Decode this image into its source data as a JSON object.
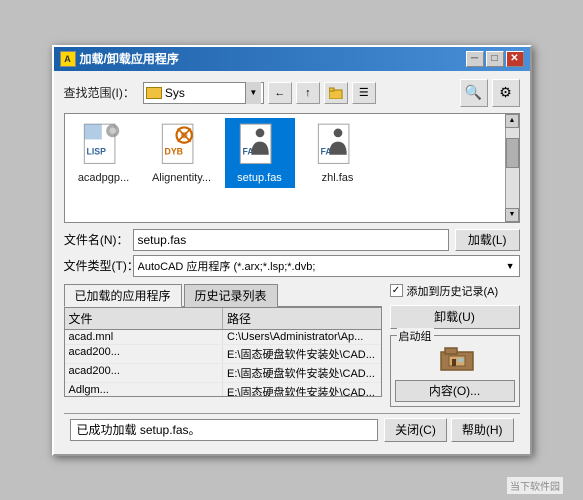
{
  "window": {
    "title": "加载/卸载应用程序",
    "title_icon": "A",
    "close_btn": "✕",
    "min_btn": "─",
    "max_btn": "□"
  },
  "search": {
    "label": "查找范围(I)：",
    "value": "Sys",
    "placeholder": "Sys"
  },
  "toolbar": {
    "back": "←",
    "up": "↑",
    "folder": "📁",
    "view": "☰",
    "search_icon": "🔍",
    "settings_icon": "⚙"
  },
  "files": [
    {
      "name": "acadpgp...",
      "type": "LISP"
    },
    {
      "name": "Alignentity...",
      "type": "DYB"
    },
    {
      "name": "setup.fas",
      "type": "FAS",
      "selected": true
    },
    {
      "name": "zhl.fas",
      "type": "FAS"
    }
  ],
  "form": {
    "filename_label": "文件名(N)：",
    "filename_value": "setup.fas",
    "filetype_label": "文件类型(T)：",
    "filetype_value": "AutoCAD 应用程序 (*.arx;*.lsp;*.dvb;",
    "load_btn": "加载(L)"
  },
  "loaded_apps": {
    "tab1": "已加载的应用程序",
    "tab2": "历史记录列表",
    "cols": [
      "文件",
      "路径"
    ],
    "rows": [
      {
        "file": "acad.mnl",
        "path": "C:\\Users\\Administrator\\Ap..."
      },
      {
        "file": "acad200...",
        "path": "E:\\固态硬盘软件安装处\\CAD..."
      },
      {
        "file": "acad200...",
        "path": "E:\\固态硬盘软件安装处\\CAD..."
      },
      {
        "file": "Adlgm...",
        "path": "E:\\固态硬盘软件安装处\\CAD..."
      }
    ]
  },
  "right_panel": {
    "checkbox_label": "添加到历史记录(A)",
    "checked": true,
    "unload_btn": "卸载(U)",
    "startup_group_label": "启动组",
    "content_btn": "内容(O)..."
  },
  "status": {
    "text": "已成功加载 setup.fas。",
    "close_btn": "关闭(C)",
    "help_btn": "帮助(H)"
  },
  "watermark": "当下软件园"
}
